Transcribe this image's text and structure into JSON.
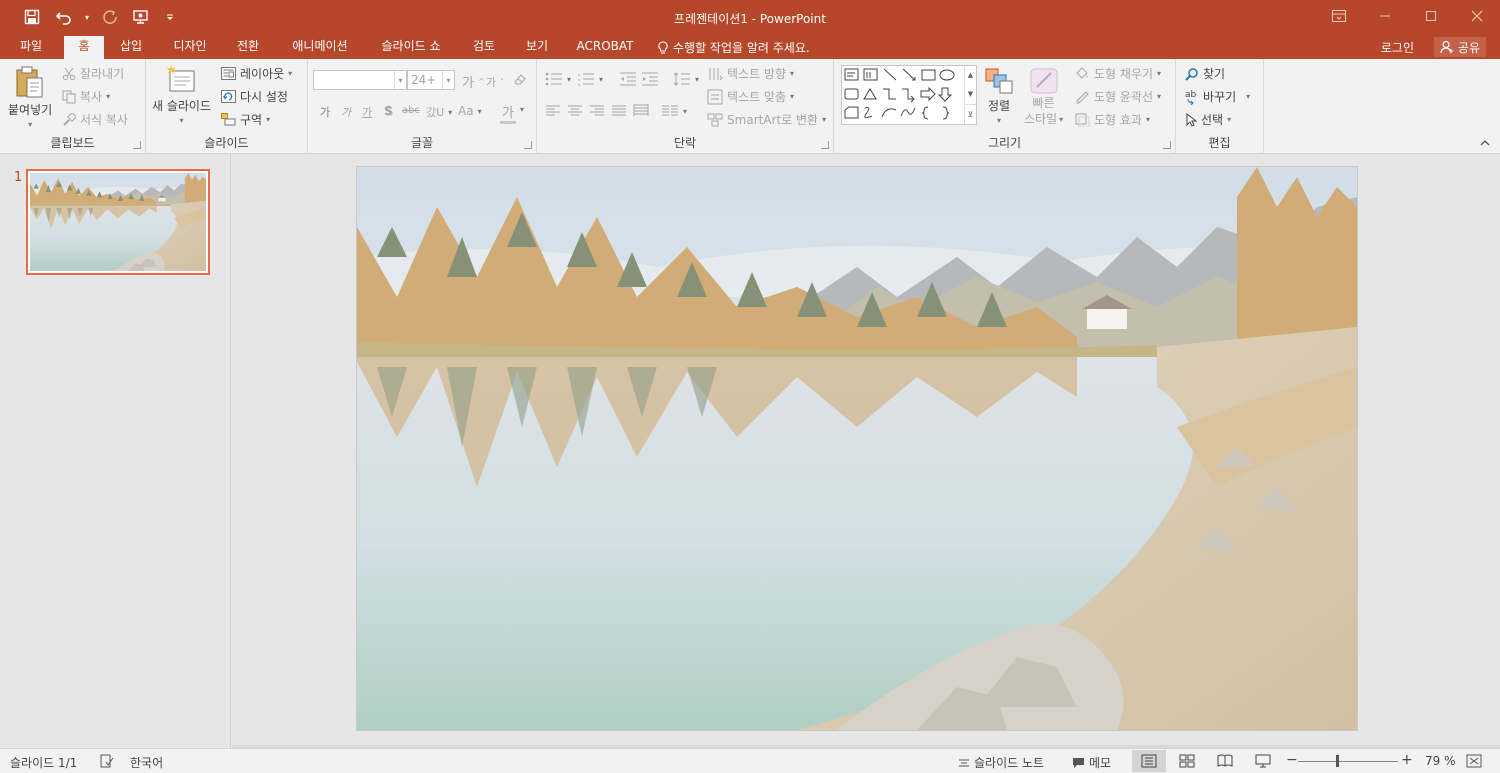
{
  "titlebar": {
    "title": "프레젠테이션1 - PowerPoint"
  },
  "tabs": [
    {
      "label": "파일"
    },
    {
      "label": "홈"
    },
    {
      "label": "삽입"
    },
    {
      "label": "디자인"
    },
    {
      "label": "전환"
    },
    {
      "label": "애니메이션"
    },
    {
      "label": "슬라이드 쇼"
    },
    {
      "label": "검토"
    },
    {
      "label": "보기"
    },
    {
      "label": "ACROBAT"
    }
  ],
  "active_tab": "홈",
  "tellme": "수행할 작업을 알려 주세요.",
  "account": {
    "login": "로그인",
    "share": "공유"
  },
  "ribbon": {
    "clipboard": {
      "label": "클립보드",
      "paste": "붙여넣기",
      "cut": "잘라내기",
      "copy": "복사",
      "format_painter": "서식 복사"
    },
    "slides": {
      "label": "슬라이드",
      "new_slide": "새 슬라이드",
      "layout": "레이아웃",
      "reset": "다시 설정",
      "section": "구역"
    },
    "font": {
      "label": "글꼴",
      "font_name": "",
      "font_size": "24+",
      "grow": "가",
      "shrink": "가",
      "bold": "가",
      "italic": "가",
      "underline": "가",
      "shadow": "S",
      "strike": "abc",
      "spacing": "갔U",
      "case": "Aa",
      "color": "가"
    },
    "paragraph": {
      "label": "단락",
      "text_direction": "텍스트 방향",
      "align_text": "텍스트 맞춤",
      "smartart": "SmartArt로 변환"
    },
    "drawing": {
      "label": "그리기",
      "arrange": "정렬",
      "quick_styles_1": "빠른",
      "quick_styles_2": "스타일",
      "shape_fill": "도형 채우기",
      "shape_outline": "도형 윤곽선",
      "shape_effects": "도형 효과"
    },
    "editing": {
      "label": "편집",
      "find": "찾기",
      "replace": "바꾸기",
      "select": "선택"
    }
  },
  "thumbnails": [
    {
      "number": "1"
    }
  ],
  "statusbar": {
    "slide_info": "슬라이드 1/1",
    "language": "한국어",
    "notes": "슬라이드 노트",
    "comments": "메모",
    "zoom": "79 %",
    "zoom_level": 0.79
  },
  "colors": {
    "accent": "#b7472a",
    "ribbon_bg": "#f2f2f2",
    "workspace_bg": "#e6e6e6",
    "thumb_border": "#e46c4a"
  }
}
